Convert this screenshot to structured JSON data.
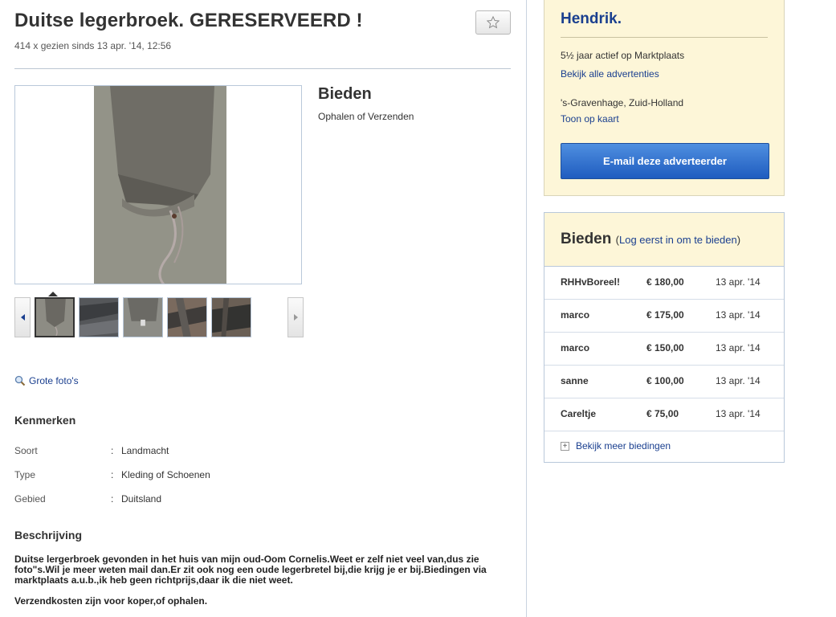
{
  "listing": {
    "title": "Duitse legerbroek. GERESERVEERD !",
    "views": "414 x gezien sinds 13 apr. '14, 12:56",
    "bid_heading": "Bieden",
    "delivery": "Ophalen of Verzenden",
    "large_photos_label": "Grote foto's",
    "icons": {
      "favorite": "star-icon",
      "zoom": "magnifier-icon",
      "prev": "chevron-left-icon",
      "next": "chevron-right-icon"
    }
  },
  "properties": {
    "heading": "Kenmerken",
    "rows": [
      {
        "key": "Soort",
        "sep": ":",
        "value": "Landmacht"
      },
      {
        "key": "Type",
        "sep": ":",
        "value": "Kleding of Schoenen"
      },
      {
        "key": "Gebied",
        "sep": ":",
        "value": "Duitsland"
      }
    ]
  },
  "description": {
    "heading": "Beschrijving",
    "paragraph1": "Duitse lergerbroek gevonden in het huis van mijn oud-Oom Cornelis.Weet er zelf niet veel van,dus zie foto\"s.Wil je meer weten mail dan.Er zit ook nog een oude legerbretel bij,die krijg je er bij.Biedingen via marktplaats a.u.b.,ik heb geen richtprijs,daar ik die niet weet.",
    "paragraph2": "Verzendkosten zijn voor koper,of ophalen."
  },
  "seller": {
    "name": "Hendrik.",
    "active": "5½ jaar actief op Marktplaats",
    "all_ads_link": "Bekijk alle advertenties",
    "location": "'s-Gravenhage, Zuid-Holland",
    "map_link": "Toon op kaart",
    "email_button": "E-mail deze adverteerder"
  },
  "bids": {
    "heading": "Bieden",
    "open_paren": "(",
    "login_link": "Log eerst in om te bieden",
    "close_paren": ")",
    "rows": [
      {
        "name": "RHHvBoreel!",
        "amount": "€ 180,00",
        "date": "13 apr. '14"
      },
      {
        "name": "marco",
        "amount": "€ 175,00",
        "date": "13 apr. '14"
      },
      {
        "name": "marco",
        "amount": "€ 150,00",
        "date": "13 apr. '14"
      },
      {
        "name": "sanne",
        "amount": "€ 100,00",
        "date": "13 apr. '14"
      },
      {
        "name": "Careltje",
        "amount": "€ 75,00",
        "date": "13 apr. '14"
      }
    ],
    "more_icon": "plus",
    "more_link": "Bekijk meer biedingen"
  },
  "colors": {
    "link": "#1a3f8f",
    "seller_bg": "#fdf6d8",
    "button": "#1f5cbf"
  }
}
